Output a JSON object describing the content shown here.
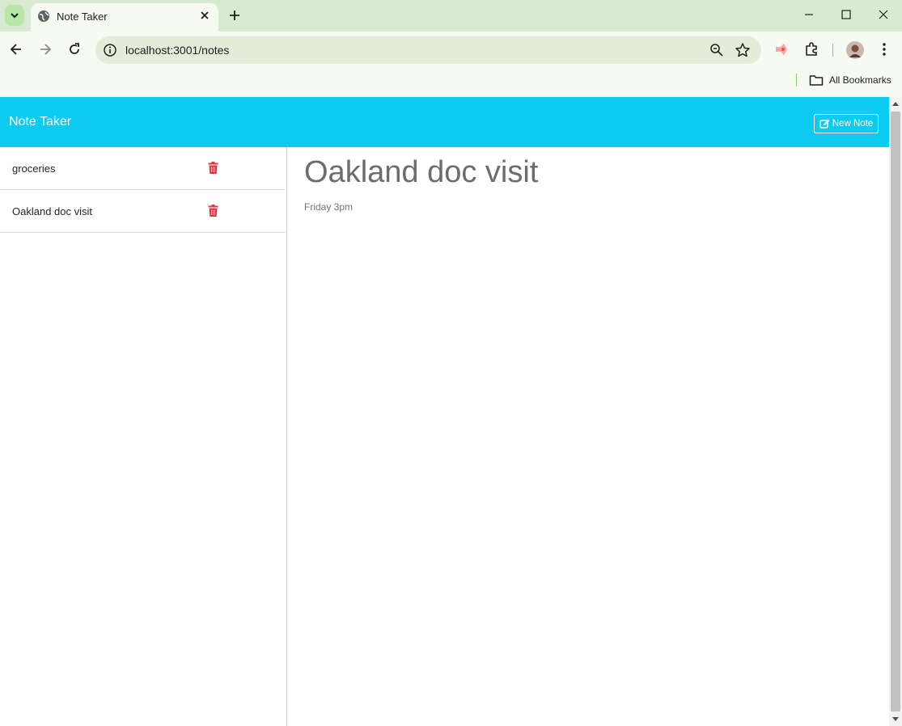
{
  "browser": {
    "tab_title": "Note Taker",
    "url": "localhost:3001/notes",
    "bookmarks_label": "All Bookmarks"
  },
  "app": {
    "brand": "Note Taker",
    "new_note_label": "New Note",
    "accent_color": "#0dcaf0",
    "delete_color": "#dc3545"
  },
  "notes": [
    {
      "title": "groceries"
    },
    {
      "title": "Oakland doc visit"
    }
  ],
  "active_note": {
    "title": "Oakland doc visit",
    "text": "Friday 3pm"
  }
}
